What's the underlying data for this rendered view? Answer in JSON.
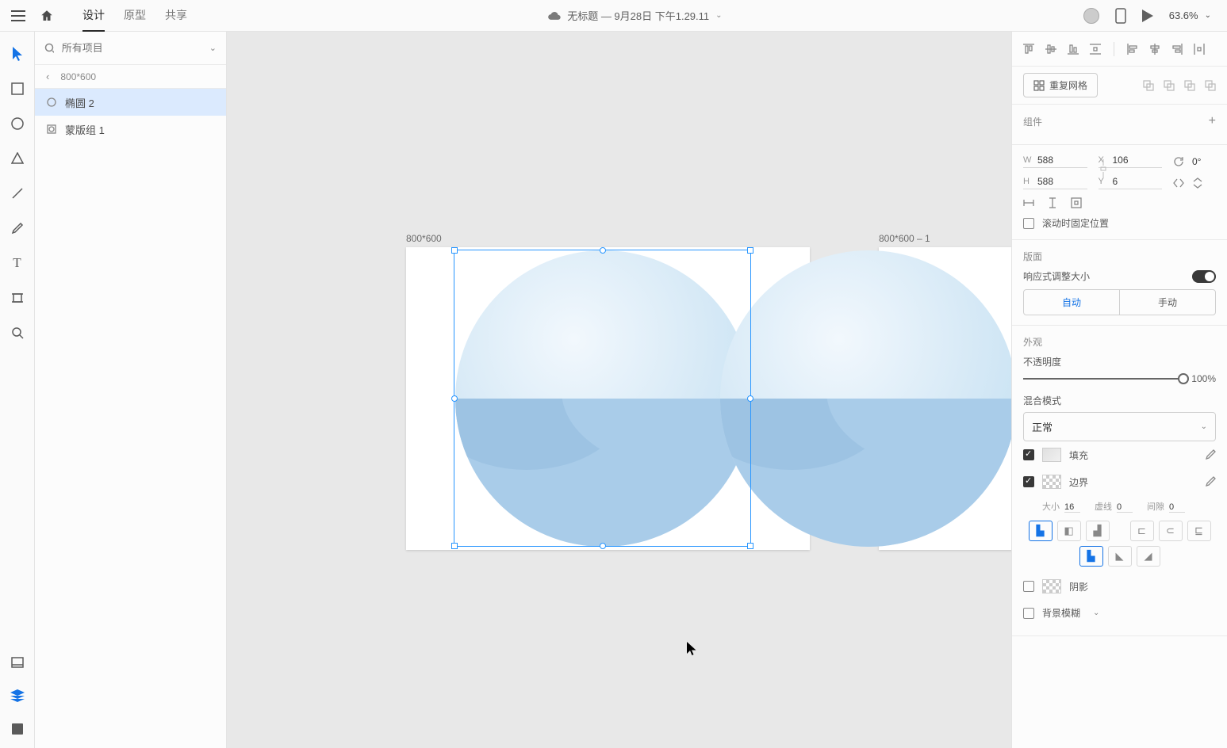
{
  "topbar": {
    "tabs": {
      "design": "设计",
      "prototype": "原型",
      "share": "共享"
    },
    "doc_title": "无标题 — 9月28日 下午1.29.11",
    "zoom": "63.6%"
  },
  "layers": {
    "search_placeholder": "所有项目",
    "breadcrumb": "800*600",
    "items": [
      {
        "name": "椭圆 2",
        "selected": true,
        "type": "ellipse"
      },
      {
        "name": "蒙版组 1",
        "selected": false,
        "type": "mask"
      }
    ]
  },
  "canvas": {
    "artboard1_label": "800*600",
    "artboard2_label": "800*600 – 1"
  },
  "inspector": {
    "repeat_grid": "重复网格",
    "components_title": "组件",
    "transform": {
      "w": "588",
      "h": "588",
      "x": "106",
      "y": "6",
      "rotation": "0°"
    },
    "fix_scroll": "滚动时固定位置",
    "layout_title": "版面",
    "responsive_label": "响应式调整大小",
    "seg_auto": "自动",
    "seg_manual": "手动",
    "appearance_title": "外观",
    "opacity_label": "不透明度",
    "opacity_value": "100%",
    "blend_label": "混合模式",
    "blend_value": "正常",
    "fill_label": "填充",
    "border_label": "边界",
    "stroke": {
      "size_lbl": "大小",
      "size": "16",
      "dash_lbl": "虚线",
      "dash": "0",
      "gap_lbl": "间隙",
      "gap": "0"
    },
    "shadow_label": "阴影",
    "bgblur_label": "背景模糊"
  }
}
